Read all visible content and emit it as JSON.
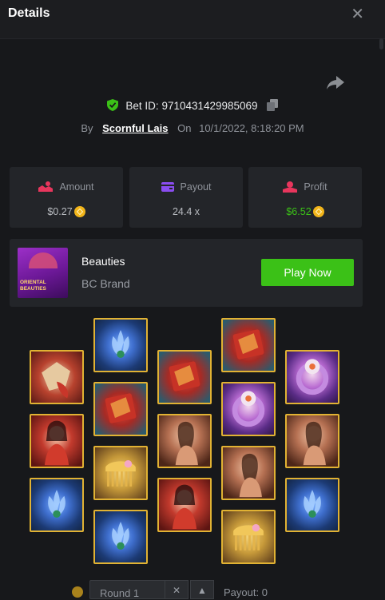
{
  "header": {
    "title": "Details",
    "close_glyph": "✕"
  },
  "bet": {
    "id_label": "Bet ID:",
    "id_value": "9710431429985069",
    "by_label": "By",
    "user": "Scornful Lais",
    "on_label": "On",
    "datetime": "10/1/2022, 8:18:20 PM"
  },
  "stats": {
    "amount": {
      "label": "Amount",
      "value": "$0.27",
      "color": "#b9bcc1"
    },
    "payout": {
      "label": "Payout",
      "value": "24.4 x",
      "color": "#b9bcc1"
    },
    "profit": {
      "label": "Profit",
      "value": "$6.52",
      "color": "#3bc117"
    }
  },
  "game": {
    "thumb_text": "ORIENTAL BEAUTIES",
    "name": "Beauties",
    "brand": "BC Brand",
    "play_label": "Play Now"
  },
  "reels": [
    [
      "lantern",
      "red",
      "lotus"
    ],
    [
      "lotus",
      "book",
      "comb",
      "lotus"
    ],
    [
      "book",
      "lady",
      "red"
    ],
    [
      "book",
      "ring",
      "lady",
      "comb"
    ],
    [
      "ring",
      "lady",
      "lotus"
    ]
  ],
  "footer": {
    "round_label": "Round 1",
    "payout_label": "Payout: 0"
  },
  "colors": {
    "accent_green": "#3bc117",
    "coin": "#f2b51a",
    "tile_border": "#e1b233"
  }
}
